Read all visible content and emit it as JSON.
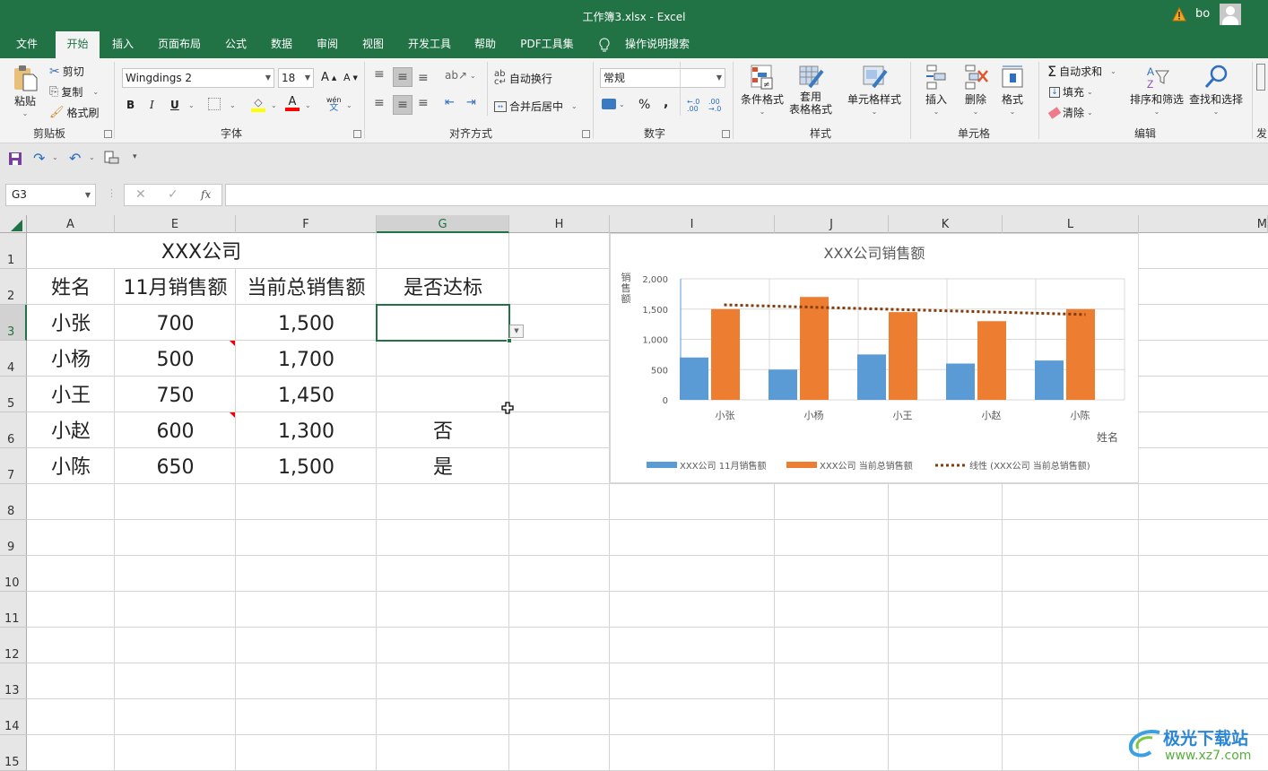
{
  "window": {
    "title": "工作簿3.xlsx  -  Excel",
    "user": "bo"
  },
  "tabs": [
    {
      "label": "文件",
      "active": false
    },
    {
      "label": "开始",
      "active": true
    },
    {
      "label": "插入",
      "active": false
    },
    {
      "label": "页面布局",
      "active": false
    },
    {
      "label": "公式",
      "active": false
    },
    {
      "label": "数据",
      "active": false
    },
    {
      "label": "审阅",
      "active": false
    },
    {
      "label": "视图",
      "active": false
    },
    {
      "label": "开发工具",
      "active": false
    },
    {
      "label": "帮助",
      "active": false
    },
    {
      "label": "PDF工具集",
      "active": false
    }
  ],
  "tell_me": "操作说明搜索",
  "ribbon": {
    "clipboard": {
      "label": "剪贴板",
      "paste": "粘贴",
      "cut": "剪切",
      "copy": "复制",
      "format_painter": "格式刷"
    },
    "font": {
      "label": "字体",
      "font_name": "Wingdings 2",
      "font_size": "18",
      "bold": "B",
      "italic": "I",
      "underline": "U",
      "phonetic": "wén",
      "fill_color": "#ffff00",
      "font_color": "#ff0000"
    },
    "alignment": {
      "label": "对齐方式",
      "wrap": "自动换行",
      "merge": "合并后居中"
    },
    "number": {
      "label": "数字",
      "format": "常规",
      "percent": "%",
      "comma": ","
    },
    "styles": {
      "label": "样式",
      "conditional": "条件格式",
      "table_line1": "套用",
      "table_line2": "表格格式",
      "cell_styles": "单元格样式"
    },
    "cells": {
      "label": "单元格",
      "insert": "插入",
      "delete": "删除",
      "format": "格式"
    },
    "editing": {
      "label": "编辑",
      "autosum": "自动求和",
      "fill": "填充",
      "clear": "清除",
      "sort": "排序和筛选",
      "find": "查找和选择"
    },
    "next_group_partial": "发"
  },
  "formula_bar": {
    "name_box": "G3",
    "fx": "fx",
    "value": ""
  },
  "columns": [
    {
      "label": "A",
      "selected": false
    },
    {
      "label": "E",
      "selected": false
    },
    {
      "label": "F",
      "selected": false
    },
    {
      "label": "G",
      "selected": true
    },
    {
      "label": "H",
      "selected": false
    },
    {
      "label": "I",
      "selected": false
    },
    {
      "label": "J",
      "selected": false
    },
    {
      "label": "K",
      "selected": false
    },
    {
      "label": "L",
      "selected": false
    },
    {
      "label": "M",
      "selected": false
    }
  ],
  "rows": [
    "1",
    "2",
    "3",
    "4",
    "5",
    "6",
    "7",
    "8",
    "9",
    "10",
    "11",
    "12",
    "13",
    "14",
    "15"
  ],
  "selected_row": "3",
  "sheet": {
    "title": "XXX公司",
    "headers": [
      "姓名",
      "11月销售额",
      "当前总销售额",
      "是否达标"
    ],
    "records": [
      {
        "name": "小张",
        "nov": "700",
        "total": "1,500",
        "ok": ""
      },
      {
        "name": "小杨",
        "nov": "500",
        "total": "1,700",
        "ok": ""
      },
      {
        "name": "小王",
        "nov": "750",
        "total": "1,450",
        "ok": ""
      },
      {
        "name": "小赵",
        "nov": "600",
        "total": "1,300",
        "ok": "否"
      },
      {
        "name": "小陈",
        "nov": "650",
        "total": "1,500",
        "ok": "是"
      }
    ]
  },
  "chart_data": {
    "type": "bar",
    "title": "XXX公司销售额",
    "xlabel": "姓名",
    "ylabel": "销售额",
    "categories": [
      "小张",
      "小杨",
      "小王",
      "小赵",
      "小陈"
    ],
    "series": [
      {
        "name": "XXX公司 11月销售额",
        "values": [
          700,
          500,
          750,
          600,
          650
        ],
        "color": "#5b9bd5"
      },
      {
        "name": "XXX公司 当前总销售额",
        "values": [
          1500,
          1700,
          1450,
          1300,
          1500
        ],
        "color": "#ed7d31"
      }
    ],
    "trendline": {
      "name": "线性 (XXX公司 当前总销售额)",
      "type": "linear",
      "of_series": "XXX公司 当前总销售额",
      "color": "#843c0c",
      "start": 1570,
      "end": 1410
    },
    "ylim": [
      0,
      2000
    ],
    "yticks": [
      "0",
      "500",
      "1,000",
      "1,500",
      "2,000"
    ],
    "ytick_values": [
      0,
      500,
      1000,
      1500,
      2000
    ],
    "grid": true,
    "legend": "bottom"
  },
  "watermark": {
    "brand": "极光下载站",
    "url": "www.xz7.com"
  }
}
